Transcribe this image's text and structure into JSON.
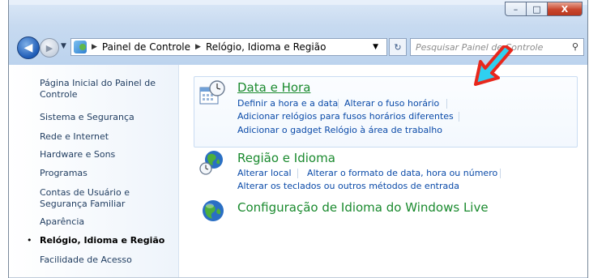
{
  "window": {
    "controls": {
      "minimize": "–",
      "maximize": "□",
      "close": "X"
    }
  },
  "nav": {
    "back_icon": "back-arrow-icon",
    "breadcrumbs": [
      "Painel de Controle",
      "Relógio, Idioma e Região"
    ],
    "search_placeholder": "Pesquisar Painel de Controle"
  },
  "sidebar": {
    "items": [
      "Página Inicial do Painel de Controle",
      "Sistema e Segurança",
      "Rede e Internet",
      "Hardware e Sons",
      "Programas",
      "Contas de Usuário e Segurança Familiar",
      "Aparência",
      "Relógio, Idioma e Região",
      "Facilidade de Acesso"
    ],
    "active_index": 7,
    "bullet": "•"
  },
  "categories": [
    {
      "title": "Data e Hora",
      "icon": "clock-calendar-icon",
      "highlighted": true,
      "links": [
        [
          "Definir a hora e a data",
          "Alterar o fuso horário"
        ],
        [
          "Adicionar relógios para fusos horários diferentes"
        ],
        [
          "Adicionar o gadget Relógio à área de trabalho"
        ]
      ]
    },
    {
      "title": "Região e Idioma",
      "icon": "globe-clock-icon",
      "highlighted": false,
      "links": [
        [
          "Alterar local",
          "Alterar o formato de data, hora ou número"
        ],
        [
          "Alterar os teclados ou outros métodos de entrada"
        ]
      ]
    },
    {
      "title": "Configuração de Idioma do Windows Live",
      "icon": "globe-icon",
      "highlighted": false,
      "links": []
    }
  ],
  "annotation": {
    "arrow_color": "#e8271c",
    "arrow_fill": "#2fd0f0"
  },
  "colors": {
    "title_green": "#1a8a2e",
    "link_blue": "#0a4aa8",
    "sidebar_text": "#1e3b5f"
  }
}
